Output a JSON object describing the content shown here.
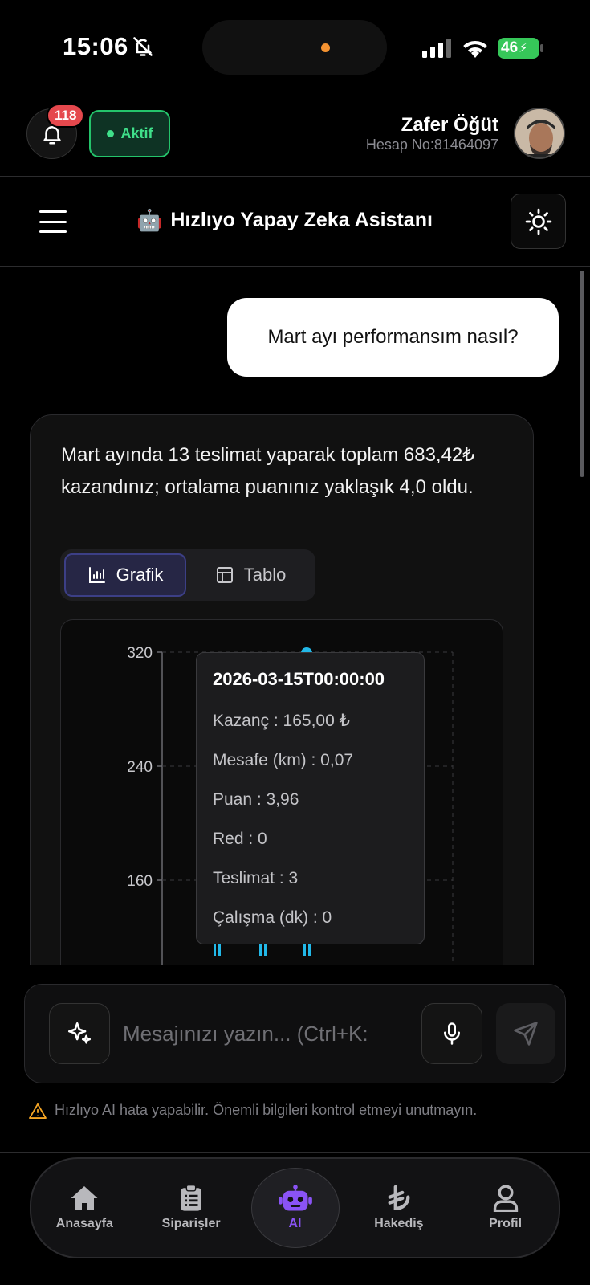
{
  "status_bar": {
    "time": "15:06",
    "battery": "46"
  },
  "header": {
    "notification_count": "118",
    "status_label": "Aktif",
    "user_name": "Zafer Öğüt",
    "account_no": "Hesap No:81464097"
  },
  "titlebar": {
    "emoji": "🤖",
    "title": "Hızlıyo Yapay Zeka Asistanı"
  },
  "chat": {
    "user_message": "Mart ayı performansım nasıl?",
    "ai_message": "Mart ayında 13 teslimat yaparak toplam 683,42₺ kazandınız; ortalama puanınız yaklaşık 4,0 oldu.",
    "view_tabs": [
      {
        "label": "Grafik"
      },
      {
        "label": "Tablo"
      }
    ],
    "tooltip": {
      "title": "2026-03-15T00:00:00",
      "rows": [
        "Kazanç : 165,00 ₺",
        "Mesafe (km) : 0,07",
        "Puan : 3,96",
        "Red : 0",
        "Teslimat : 3",
        "Çalışma (dk) : 0"
      ]
    }
  },
  "chart_data": {
    "type": "bar",
    "yticks": [
      "320",
      "240",
      "160"
    ],
    "ylim": [
      80,
      320
    ],
    "grid": true,
    "colors": {
      "bar": "#22b8e8",
      "grid": "#3a3a3d",
      "axis": "#6a6a70"
    }
  },
  "composer": {
    "placeholder": "Mesajınızı yazın... (Ctrl+K:"
  },
  "disclaimer": "Hızlıyo AI hata yapabilir. Önemli bilgileri kontrol etmeyi unutmayın.",
  "bottom_nav": [
    {
      "label": "Anasayfa",
      "icon": "home-icon"
    },
    {
      "label": "Siparişler",
      "icon": "clipboard-icon"
    },
    {
      "label": "AI",
      "icon": "robot-icon"
    },
    {
      "label": "Hakediş",
      "icon": "lira-icon"
    },
    {
      "label": "Profil",
      "icon": "user-icon"
    }
  ]
}
